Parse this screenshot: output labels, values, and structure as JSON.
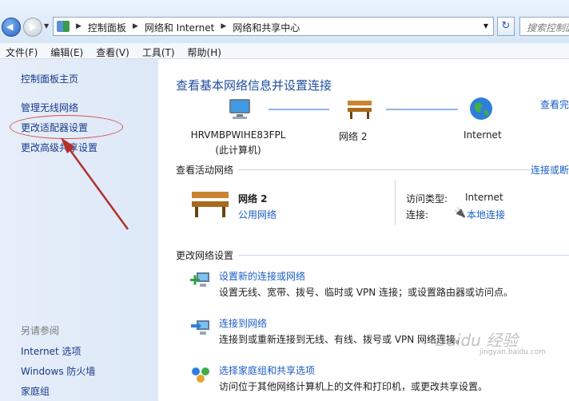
{
  "address_bar": {
    "crumbs": [
      "控制面板",
      "网络和 Internet",
      "网络和共享中心"
    ],
    "search_placeholder": "搜索控制面"
  },
  "menu": [
    "文件(F)",
    "编辑(E)",
    "查看(V)",
    "工具(T)",
    "帮助(H)"
  ],
  "sidebar": {
    "items": [
      "控制面板主页",
      "管理无线网络",
      "更改适配器设置",
      "更改高级共享设置"
    ],
    "see_also_title": "另请参阅",
    "see_also": [
      "Internet 选项",
      "Windows 防火墙",
      "家庭组"
    ]
  },
  "main": {
    "title": "查看基本网络信息并设置连接",
    "see_full_map": "查看完",
    "map": {
      "computer_name": "HRVMBPWIHE83FPL",
      "computer_sub": "(此计算机)",
      "network": "网络  2",
      "internet": "Internet"
    },
    "active_networks": {
      "header": "查看活动网络",
      "side_link": "连接或断",
      "name": "网络  2",
      "type": "公用网络",
      "access_type_label": "访问类型:",
      "access_type_value": "Internet",
      "connections_label": "连接:",
      "connections_value": "本地连接"
    },
    "change_settings": {
      "header": "更改网络设置",
      "tasks": [
        {
          "link": "设置新的连接或网络",
          "desc": "设置无线、宽带、拨号、临时或 VPN 连接；或设置路由器或访问点。",
          "icon": "new-connection-icon"
        },
        {
          "link": "连接到网络",
          "desc": "连接到或重新连接到无线、有线、拨号或 VPN 网络连接。",
          "icon": "connect-network-icon"
        },
        {
          "link": "选择家庭组和共享选项",
          "desc": "访问位于其他网络计算机上的文件和打印机，或更改共享设置。",
          "icon": "homegroup-icon"
        }
      ]
    }
  },
  "watermark": {
    "brand": "Baidu 经验",
    "url": "jingyan.baidu.com"
  },
  "colors": {
    "link": "#1a5dc4",
    "title": "#1e4e9e",
    "highlight": "#d9534f",
    "arrow": "#b3302b"
  }
}
